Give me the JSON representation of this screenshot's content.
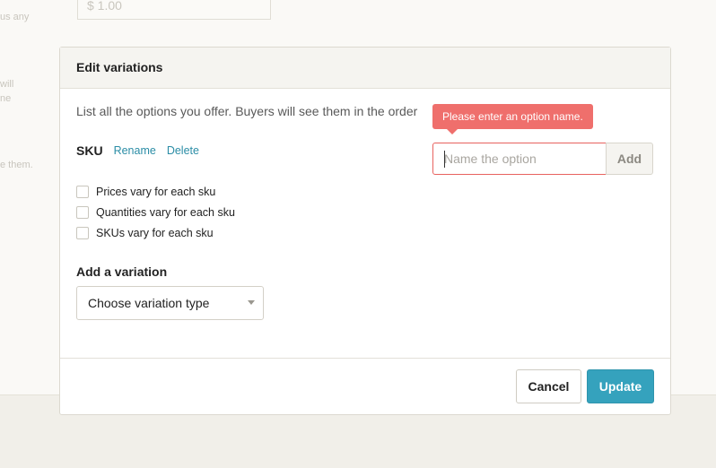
{
  "background": {
    "price_value": "$ 1.00",
    "fragments": [
      "us any",
      "will",
      "ne",
      "e them."
    ]
  },
  "modal": {
    "title": "Edit variations",
    "intro": "List all the options you offer. Buyers will see them in the order",
    "sku": {
      "title": "SKU",
      "rename_label": "Rename",
      "delete_label": "Delete"
    },
    "checkboxes": [
      {
        "label": "Prices vary for each sku",
        "checked": false
      },
      {
        "label": "Quantities vary for each sku",
        "checked": false
      },
      {
        "label": "SKUs vary for each sku",
        "checked": false
      }
    ],
    "add_variation": {
      "heading": "Add a variation",
      "select_value": "Choose variation type"
    },
    "option": {
      "placeholder": "Name the option",
      "value": "",
      "add_label": "Add",
      "error": "Please enter an option name."
    },
    "footer": {
      "cancel_label": "Cancel",
      "update_label": "Update"
    }
  },
  "colors": {
    "accent": "#35a2bd",
    "link": "#2b8da6",
    "error": "#ef6f6c"
  }
}
